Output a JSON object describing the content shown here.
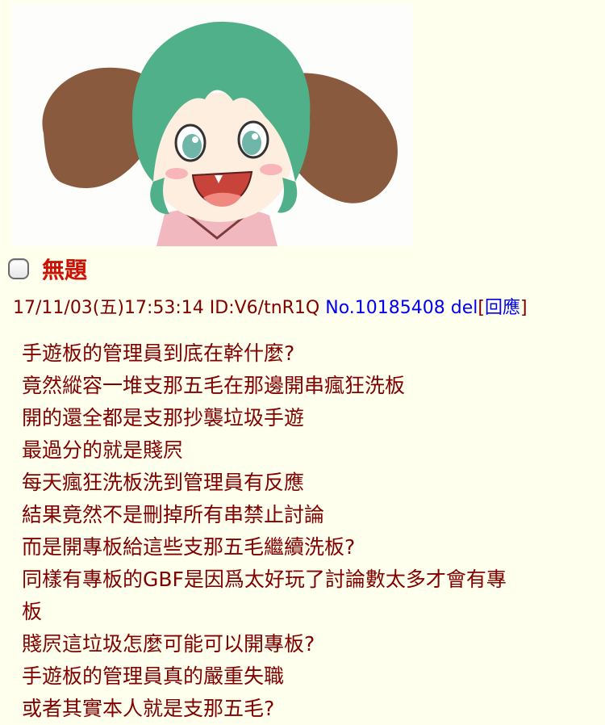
{
  "post": {
    "thumbnail": {
      "icon": "anime-girl-thumbnail",
      "colors": {
        "hair": "#4fb08a",
        "ears": "#8a5a3e",
        "skin": "#fdeee0",
        "dress": "#f2b8c0",
        "mouth": "#c8443a"
      }
    },
    "title": "無題",
    "meta": {
      "datetime": "17/11/03(五)17:53:14",
      "id": "ID:V6/tnR1Q",
      "post_no": "No.10185408",
      "del": "del",
      "bracket_open": "[",
      "reply": "回應",
      "bracket_close": "]"
    },
    "lines": [
      "手遊板的管理員到底在幹什麼?",
      "竟然縱容一堆支那五毛在那邊開串瘋狂洗板",
      "開的還全都是支那抄襲垃圾手遊",
      "最過分的就是賤屄",
      "每天瘋狂洗板洗到管理員有反應",
      "結果竟然不是刪掉所有串禁止討論",
      "而是開專板給這些支那五毛繼續洗板?",
      "同樣有專板的GBF是因爲太好玩了討論數太多才會有專",
      "板",
      "賤屄這垃圾怎麼可能可以開專板?",
      "手遊板的管理員真的嚴重失職",
      "或者其實本人就是支那五毛?"
    ],
    "colors": {
      "background": "#ffffee",
      "title": "#cc1105",
      "text": "#800000",
      "link": "#0000ee"
    }
  }
}
